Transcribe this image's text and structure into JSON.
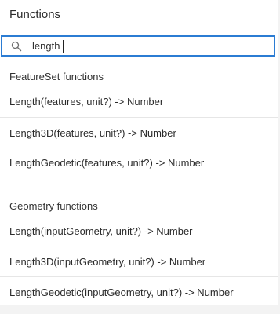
{
  "panel": {
    "title": "Functions"
  },
  "search": {
    "value": "length",
    "placeholder": ""
  },
  "groups": [
    {
      "header": "FeatureSet functions",
      "items": [
        "Length(features, unit?) -> Number",
        "Length3D(features, unit?) -> Number",
        "LengthGeodetic(features, unit?) -> Number"
      ]
    },
    {
      "header": "Geometry functions",
      "items": [
        "Length(inputGeometry, unit?) -> Number",
        "Length3D(inputGeometry, unit?) -> Number",
        "LengthGeodetic(inputGeometry, unit?) -> Number"
      ]
    }
  ],
  "icons": {
    "search": "search-icon"
  },
  "colors": {
    "focus_border": "#2b7cd3",
    "divider": "#e6e6e6",
    "text": "#323232"
  }
}
